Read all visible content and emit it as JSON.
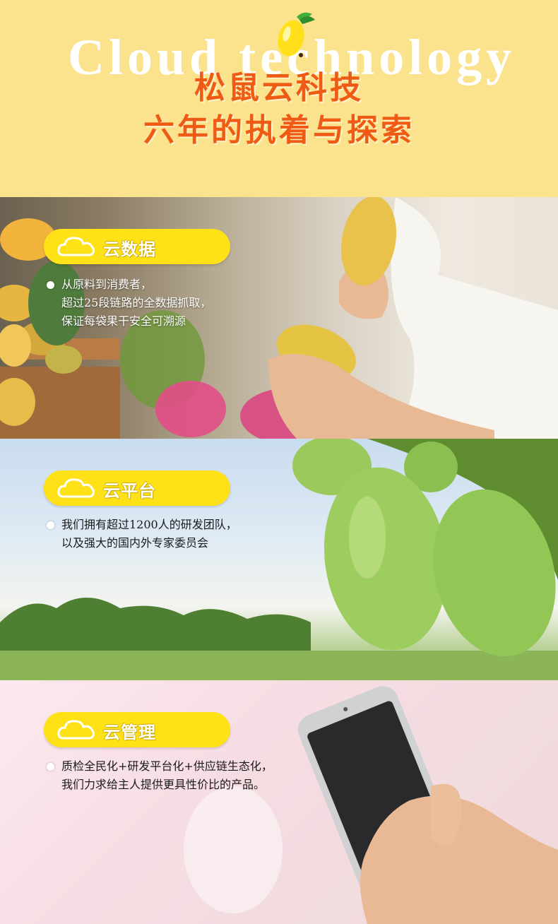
{
  "header": {
    "bg_word": "Cloud technology",
    "title_line1": "松鼠云科技",
    "title_line2": "六年的执着与探索"
  },
  "sections": [
    {
      "label": "云数据",
      "lines": [
        "从原料到消费者，",
        "超过25段链路的全数据抓取，",
        "保证每袋果干安全可溯源"
      ]
    },
    {
      "label": "云平台",
      "lines": [
        "我们拥有超过1200人的研发团队，",
        "以及强大的国内外专家委员会"
      ]
    },
    {
      "label": "云管理",
      "lines": [
        "质检全民化+研发平台化+供应链生态化，",
        "我们力求给主人提供更具性价比的产品。"
      ]
    }
  ],
  "icons": {
    "logo": "mango-logo-icon",
    "pill": "cloud-icon",
    "bullet": "bullet-dot-icon"
  },
  "colors": {
    "header_bg": "#fbe38e",
    "title": "#ef5a14",
    "pill": "#ffe118",
    "bg_word": "#ffffff"
  }
}
